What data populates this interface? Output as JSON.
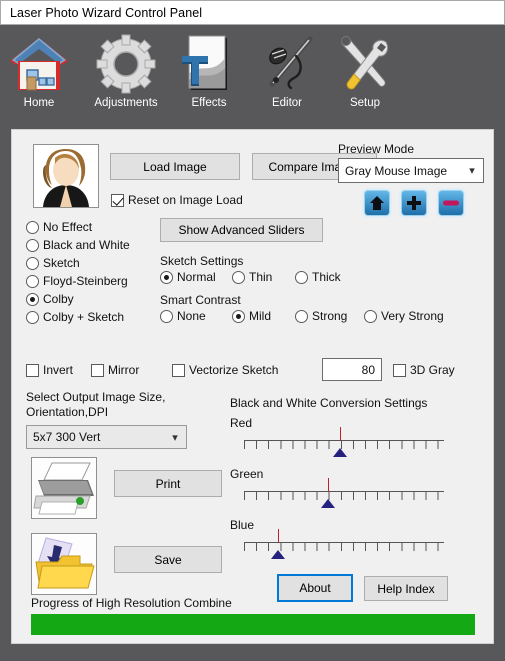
{
  "window": {
    "title": "Laser Photo Wizard Control Panel"
  },
  "toolbar": {
    "items": [
      {
        "label": "Home",
        "icon": "house-icon"
      },
      {
        "label": "Adjustments",
        "icon": "gear-icon"
      },
      {
        "label": "Effects",
        "icon": "text-effects-icon"
      },
      {
        "label": "Editor",
        "icon": "airbrush-pen-icon"
      },
      {
        "label": "Setup",
        "icon": "wrench-screwdriver-icon"
      }
    ]
  },
  "image_section": {
    "thumbnail_alt": "woman-portrait-thumbnail",
    "load_image_label": "Load Image",
    "compare_images_label": "Compare Images",
    "reset_on_load_label": "Reset on Image Load",
    "reset_on_load_checked": true
  },
  "preview": {
    "group_label": "Preview Mode",
    "selected": "Gray Mouse Image",
    "options": [
      "Gray Mouse Image"
    ],
    "nav_buttons": [
      {
        "icon": "home-icon",
        "name": "preview-home-button"
      },
      {
        "icon": "plus-icon",
        "name": "preview-zoom-in-button"
      },
      {
        "icon": "minus-icon",
        "name": "preview-zoom-out-button"
      }
    ]
  },
  "effects": {
    "options": [
      {
        "label": "No Effect",
        "selected": false
      },
      {
        "label": "Black and White",
        "selected": false
      },
      {
        "label": "Sketch",
        "selected": false
      },
      {
        "label": "Floyd-Steinberg",
        "selected": false
      },
      {
        "label": "Colby",
        "selected": true
      },
      {
        "label": "Colby + Sketch",
        "selected": false
      }
    ]
  },
  "advanced": {
    "show_advanced_sliders_label": "Show Advanced Sliders"
  },
  "sketch_settings": {
    "group_label": "Sketch Settings",
    "options": [
      {
        "label": "Normal",
        "selected": true
      },
      {
        "label": "Thin",
        "selected": false
      },
      {
        "label": "Thick",
        "selected": false
      }
    ]
  },
  "smart_contrast": {
    "group_label": "Smart Contrast",
    "options": [
      {
        "label": "None",
        "selected": false
      },
      {
        "label": "Mild",
        "selected": true
      },
      {
        "label": "Strong",
        "selected": false
      },
      {
        "label": "Very Strong",
        "selected": false
      }
    ]
  },
  "toggles": {
    "invert": {
      "label": "Invert",
      "checked": false
    },
    "mirror": {
      "label": "Mirror",
      "checked": false
    },
    "vectorize_sketch": {
      "label": "Vectorize Sketch",
      "checked": false
    },
    "three_d_gray": {
      "label": "3D Gray",
      "checked": false
    }
  },
  "threshold": {
    "value": "80"
  },
  "output_size": {
    "label_line1": "Select Output Image Size,",
    "label_line2": "Orientation,DPI",
    "selected": "5x7 300 Vert",
    "options": [
      "5x7 300 Vert"
    ]
  },
  "actions": {
    "print_label": "Print",
    "save_label": "Save",
    "print_icon": "printer-icon",
    "save_icon": "save-folder-icon"
  },
  "bw_conversion": {
    "group_label": "Black and White Conversion Settings",
    "sliders": [
      {
        "label": "Red",
        "percent": 48
      },
      {
        "label": "Green",
        "percent": 42
      },
      {
        "label": "Blue",
        "percent": 17
      }
    ]
  },
  "help": {
    "about_label": "About",
    "about_focused": true,
    "help_index_label": "Help Index"
  },
  "progress": {
    "label": "Progress of High Resolution Combine",
    "percent": 100,
    "color": "#14a814"
  }
}
